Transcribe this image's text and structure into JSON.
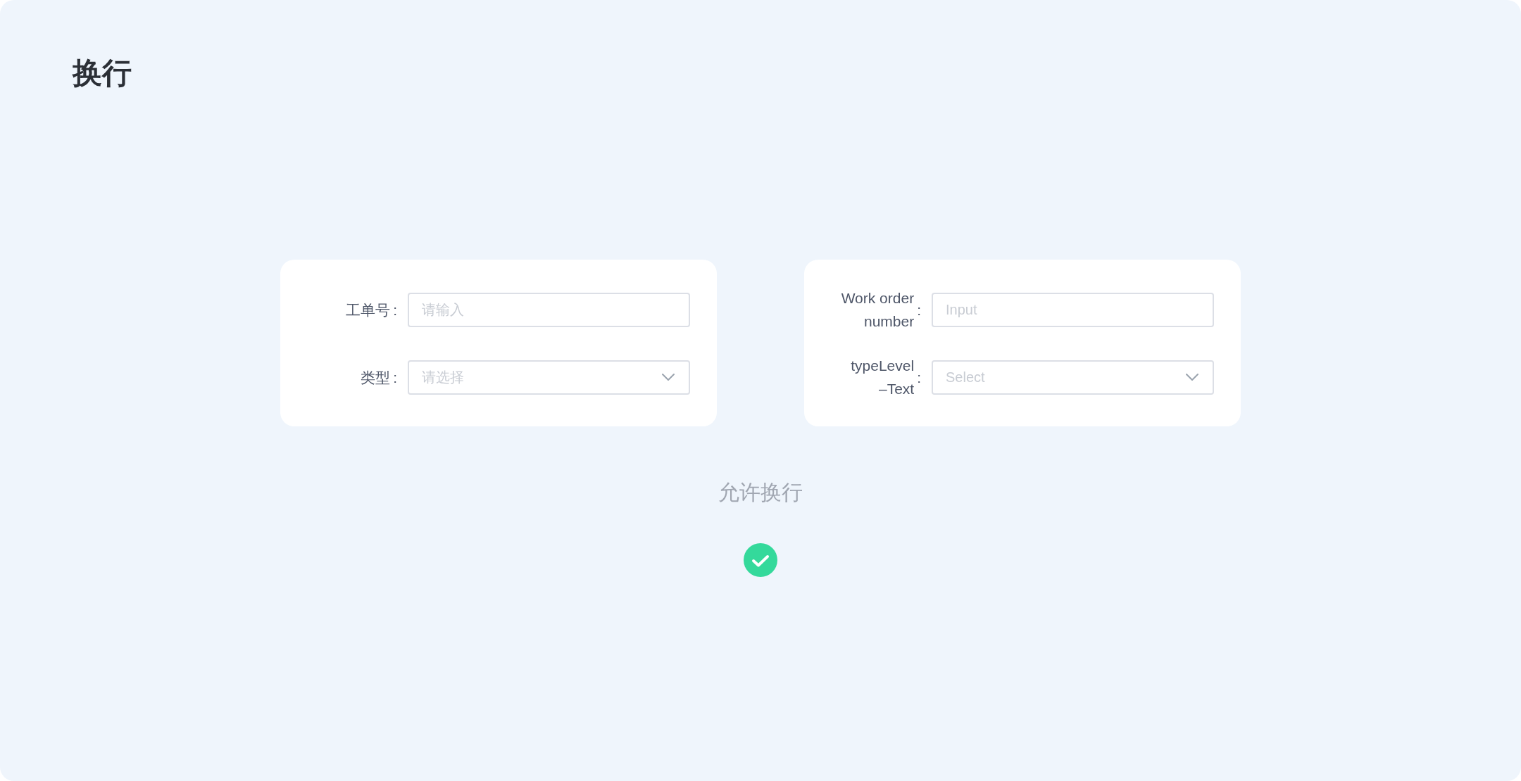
{
  "page": {
    "title": "换行"
  },
  "forms": [
    {
      "fields": [
        {
          "kind": "input",
          "label": "工单号",
          "colon": ":",
          "placeholder": "请输入"
        },
        {
          "kind": "select",
          "label": "类型",
          "colon": ":",
          "placeholder": "请选择"
        }
      ]
    },
    {
      "fields": [
        {
          "kind": "input",
          "label": "Work order number",
          "colon": ":",
          "placeholder": "Input"
        },
        {
          "kind": "select",
          "label": "typeLevel\n–Text",
          "colon": ":",
          "placeholder": "Select"
        }
      ]
    }
  ],
  "wrap_option": {
    "label": "允许换行",
    "checked": true
  }
}
